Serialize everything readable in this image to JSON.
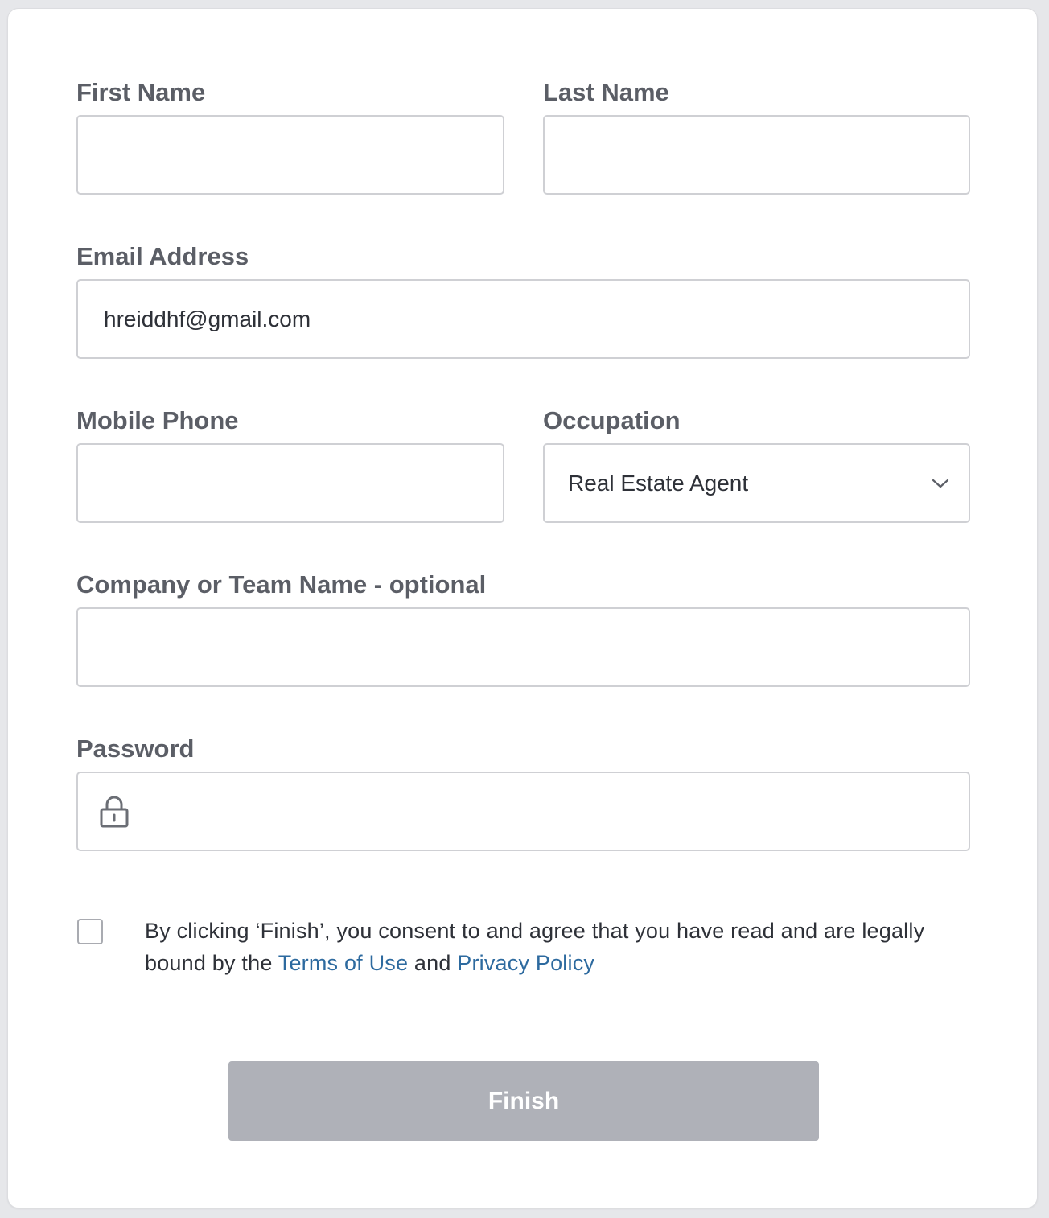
{
  "form": {
    "first_name": {
      "label": "First Name",
      "value": ""
    },
    "last_name": {
      "label": "Last Name",
      "value": ""
    },
    "email": {
      "label": "Email Address",
      "value": "hreiddhf@gmail.com"
    },
    "mobile_phone": {
      "label": "Mobile Phone",
      "value": ""
    },
    "occupation": {
      "label": "Occupation",
      "selected": "Real Estate Agent"
    },
    "company": {
      "label": "Company or Team Name - optional",
      "value": ""
    },
    "password": {
      "label": "Password",
      "value": ""
    }
  },
  "consent": {
    "checked": false,
    "text_before": "By clicking ‘Finish’, you consent to and agree that you have read and are legally bound by the ",
    "terms_link": "Terms of Use",
    "text_middle": " and ",
    "privacy_link": "Privacy Policy"
  },
  "finish_button": {
    "label": "Finish",
    "enabled": false
  },
  "colors": {
    "label": "#5b5e66",
    "link": "#2d6a9f",
    "button_disabled": "#afb1b8",
    "border": "#cfd0d4"
  },
  "icons": {
    "occupation_dropdown": "chevron-down-icon",
    "password_field": "lock-icon"
  }
}
